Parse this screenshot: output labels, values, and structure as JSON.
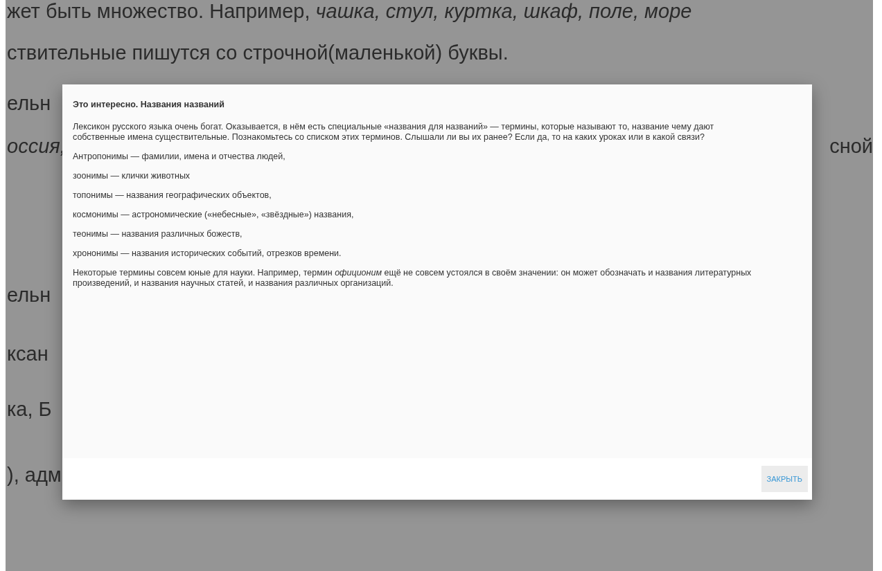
{
  "background_text": [
    {
      "left": "жет быть множество. Например, *чашка, стул, куртка, шкаф, поле, море*"
    },
    {
      "left": "ствительные пишутся со строчной(маленькой) буквы."
    },
    {
      "left": "ельн"
    },
    {
      "left": "*оссия,*",
      "right": "сной"
    },
    {
      "left": "ельн"
    },
    {
      "left": "ксан"
    },
    {
      "left": "ка, Б"
    },
    {
      "left": "), адм"
    }
  ],
  "dialog": {
    "title": "Это интересно. Названия названий",
    "paragraphs": [
      "Лексикон русского языка очень богат. Оказывается, в нём есть специальные «названия для названий» — термины, которые называют то, название чему дают собственные имена существительные. Познакомьтесь со списком этих терминов. Слышали ли вы их ранее? Если да, то на каких уроках или в какой связи?",
      "Антропонимы — фамилии, имена и отчества людей,",
      "зоонимы — клички животных",
      "топонимы — названия географических объектов,",
      "космонимы — астрономические («небесные», «звёздные») названия,",
      "теонимы — названия различных божеств,",
      "хрононимы — названия исторических событий, отрезков времени.",
      "Некоторые термины совсем юные для науки. Например, термин *официоним* ещё не совсем устоялся в своём значении: он может обозначать и названия литературных произведений, и названия научных статей, и названия различных организаций."
    ],
    "close_button": "ЗАКРЫТЬ"
  }
}
